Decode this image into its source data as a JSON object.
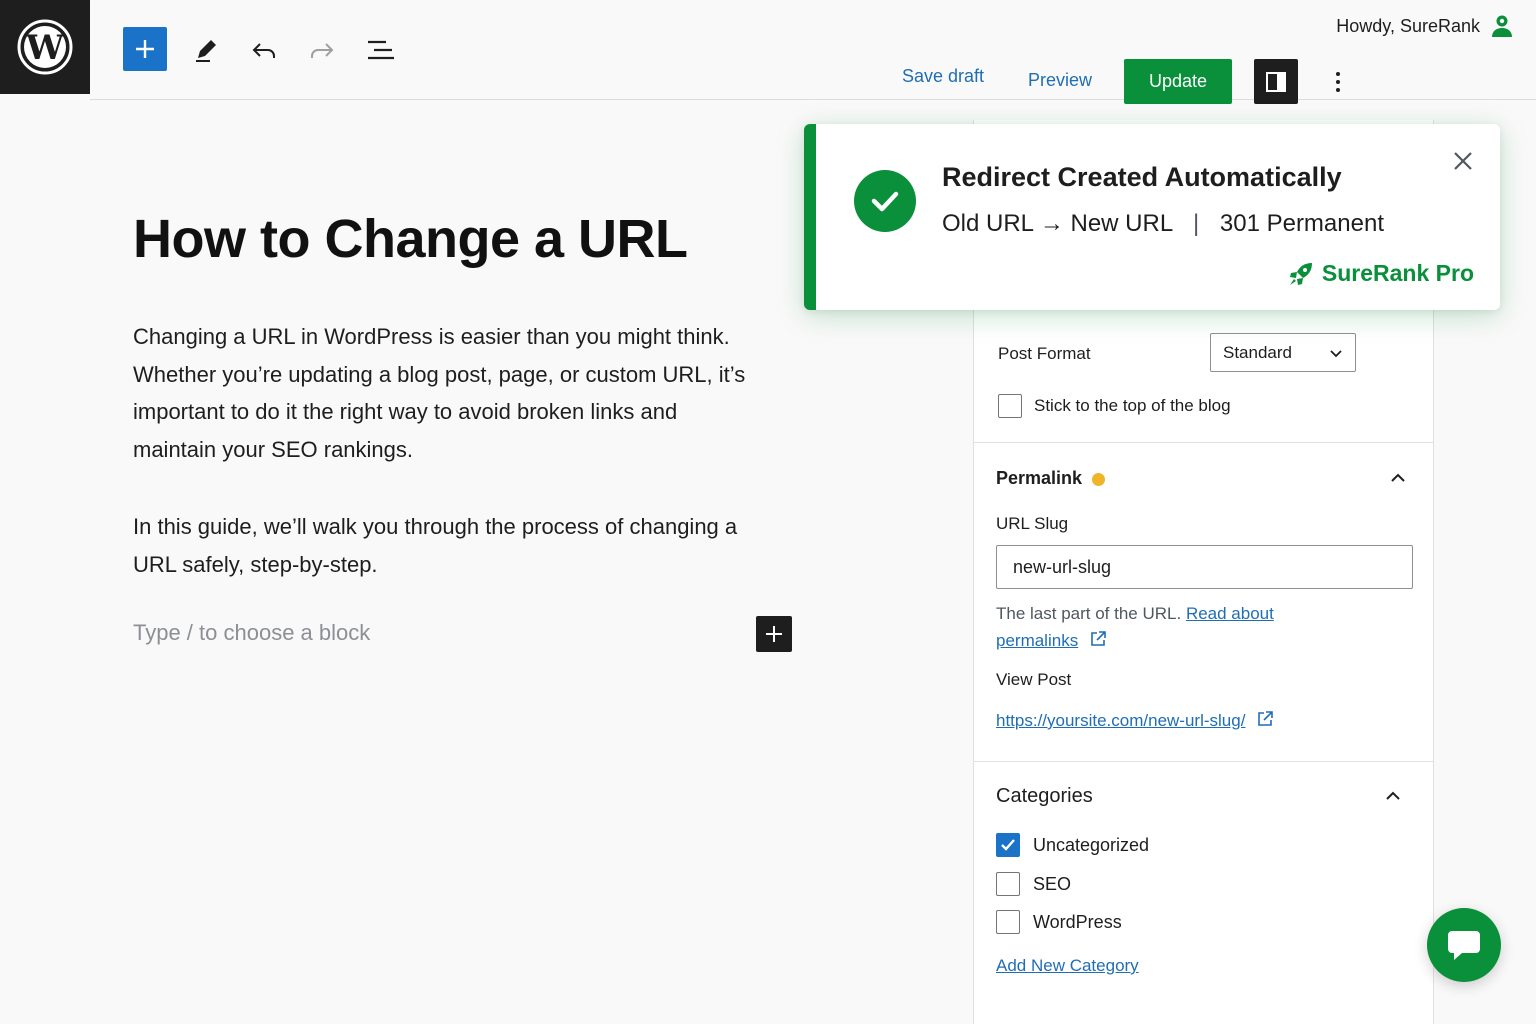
{
  "header": {
    "howdy": "Howdy, SureRank",
    "save_draft": "Save draft",
    "preview": "Preview",
    "update": "Update"
  },
  "editor": {
    "title": "How to Change a URL",
    "paragraph_1": "Changing a URL in WordPress is easier than you might think. Whether you’re updating a blog post, page, or custom URL, it’s important to do it the right way to avoid broken links and maintain your SEO rankings.",
    "paragraph_2": "In this guide, we’ll walk you through the process of changing a URL safely, step-by-step.",
    "placeholder": "Type / to choose a block"
  },
  "sidebar": {
    "post_format_label": "Post Format",
    "post_format_value": "Standard",
    "sticky_label": "Stick to the top of the blog",
    "permalink_title": "Permalink",
    "url_slug_label": "URL Slug",
    "url_slug_value": "new-url-slug",
    "help_text": "The last part of the URL.",
    "help_link_1": "Read about",
    "help_link_2": "permalinks",
    "view_post_label": "View Post",
    "view_post_url": "https://yoursite.com/new-url-slug/",
    "categories_title": "Categories",
    "categories": [
      {
        "label": "Uncategorized",
        "checked": true
      },
      {
        "label": "SEO",
        "checked": false
      },
      {
        "label": "WordPress",
        "checked": false
      }
    ],
    "add_category": "Add New Category"
  },
  "toast": {
    "title": "Redirect Created Automatically",
    "old_url": "Old URL",
    "arrow": "→",
    "new_url": "New URL",
    "separator": "|",
    "redirect_type": "301 Permanent",
    "brand": "SureRank Pro"
  },
  "colors": {
    "accent_green": "#0a8f3a",
    "accent_blue": "#1a73c9",
    "link_blue": "#1f6eb5",
    "warning_dot": "#f0b429"
  }
}
